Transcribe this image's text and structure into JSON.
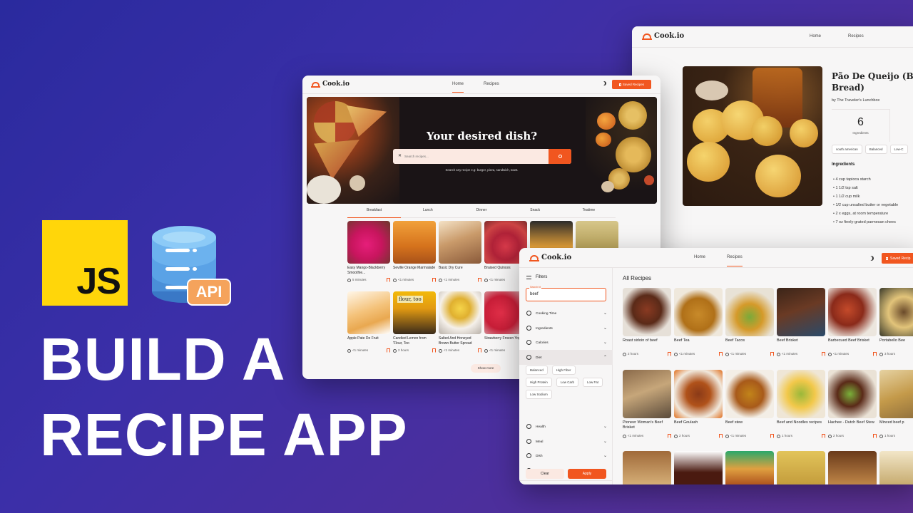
{
  "hero": {
    "title_line1": "BUILD A",
    "title_line2": "RECIPE APP",
    "js_badge": "JS",
    "api_badge": "API",
    "colors": {
      "js_yellow": "#ffd60a",
      "db_blue": "#4a8fd8",
      "api_orange": "#f5a35c",
      "accent": "#f1561f"
    }
  },
  "w1": {
    "logo": "Cook.io",
    "nav": [
      "Home",
      "Recipes"
    ],
    "saved_label": "Saved Recipes",
    "banner_title": "Your desired dish?",
    "search_placeholder": "Search recipes...",
    "search_hint": "Search any recipe e.g: burger, pizza, sandwich, toast.",
    "tabs": [
      "Breakfast",
      "Lunch",
      "Dinner",
      "Snack",
      "Teatime"
    ],
    "active_tab": "Breakfast",
    "row1": [
      {
        "title": "Easy Mango-Blackberry Smoothie...",
        "time": "5 minutes"
      },
      {
        "title": "Seville Orange Marmalade",
        "time": "<1 minutes"
      },
      {
        "title": "Basic Dry Cure",
        "time": "<1 minutes"
      },
      {
        "title": "Braised Quinces",
        "time": "<1 minutes"
      },
      {
        "title": "",
        "time": ""
      },
      {
        "title": "",
        "time": ""
      }
    ],
    "row2": [
      {
        "title": "Apple Pate De Fruit",
        "time": "<1 minutes"
      },
      {
        "title": "Candied Lemon from 'Flour, Too",
        "time": "2 hours"
      },
      {
        "title": "Salted And Honeyed Brown Butter Spread",
        "time": "<1 minutes"
      },
      {
        "title": "Strawberry Frozen Yogurt",
        "time": "<1 minutes"
      }
    ],
    "show_more": "Show more",
    "thumb_text": "flour, too"
  },
  "w2": {
    "logo": "Cook.io",
    "nav": [
      "Home",
      "Recipes"
    ],
    "title": "Pão De Queijo (Brazilian Cheese Bread)",
    "title_line1": "Pão De Queijo (Braz",
    "title_line2": "Bread)",
    "author": "by The Traveler's Lunchbox",
    "ingredients_count": "6",
    "ingredients_count_label": "Ingredients",
    "tags": [
      "south american",
      "Balanced",
      "Low-C"
    ],
    "ingredients_heading": "Ingredients",
    "ingredients": [
      "4 cup tapioca starch",
      "1 1/2 tsp salt",
      "1 1/2 cup milk",
      "1/2 cup unsalted butter or vegetable",
      "2 x eggs, at room temperature",
      "7 oz finely-grated parmesan chees"
    ]
  },
  "w3": {
    "logo": "Cook.io",
    "nav": [
      "Home",
      "Recipes"
    ],
    "saved_label": "Saved Recip",
    "filters_label": "Filters",
    "search_legend": "Search bt",
    "search_value": "beef",
    "filter_rows_top": [
      "Cooking Time",
      "Ingredients",
      "Calories",
      "Diet"
    ],
    "diet_chips": [
      "Balanced",
      "High Fiber",
      "High Protein",
      "Low Carb",
      "Low Fat",
      "Low Sodium"
    ],
    "filter_rows_bottom": [
      "Health",
      "Meal",
      "Dish",
      "Cuisine"
    ],
    "clear_label": "Clear",
    "apply_label": "Apply",
    "heading": "All Recipes",
    "row1": [
      {
        "title": "Roast sirloin of beef",
        "time": "2 hours"
      },
      {
        "title": "Beef Tea",
        "time": "<1 minutes"
      },
      {
        "title": "Beef Tacos",
        "time": "<1 minutes"
      },
      {
        "title": "Beef Brisket",
        "time": "<1 minutes"
      },
      {
        "title": "Barbecued Beef Brisket",
        "time": "<1 minutes"
      },
      {
        "title": "Portabello Bee",
        "time": "3 hours"
      }
    ],
    "row2": [
      {
        "title": "Pioneer Woman's Beef Brisket",
        "time": "<1 minutes"
      },
      {
        "title": "Beef Goulash",
        "time": "2 hours"
      },
      {
        "title": "Beef stew",
        "time": "<1 minutes"
      },
      {
        "title": "Beef and Noodles recipes",
        "time": "1 hours"
      },
      {
        "title": "Hachee - Dutch Beef Stew",
        "time": "2 hours"
      },
      {
        "title": "Minced beef p",
        "time": "1 hours"
      }
    ]
  }
}
